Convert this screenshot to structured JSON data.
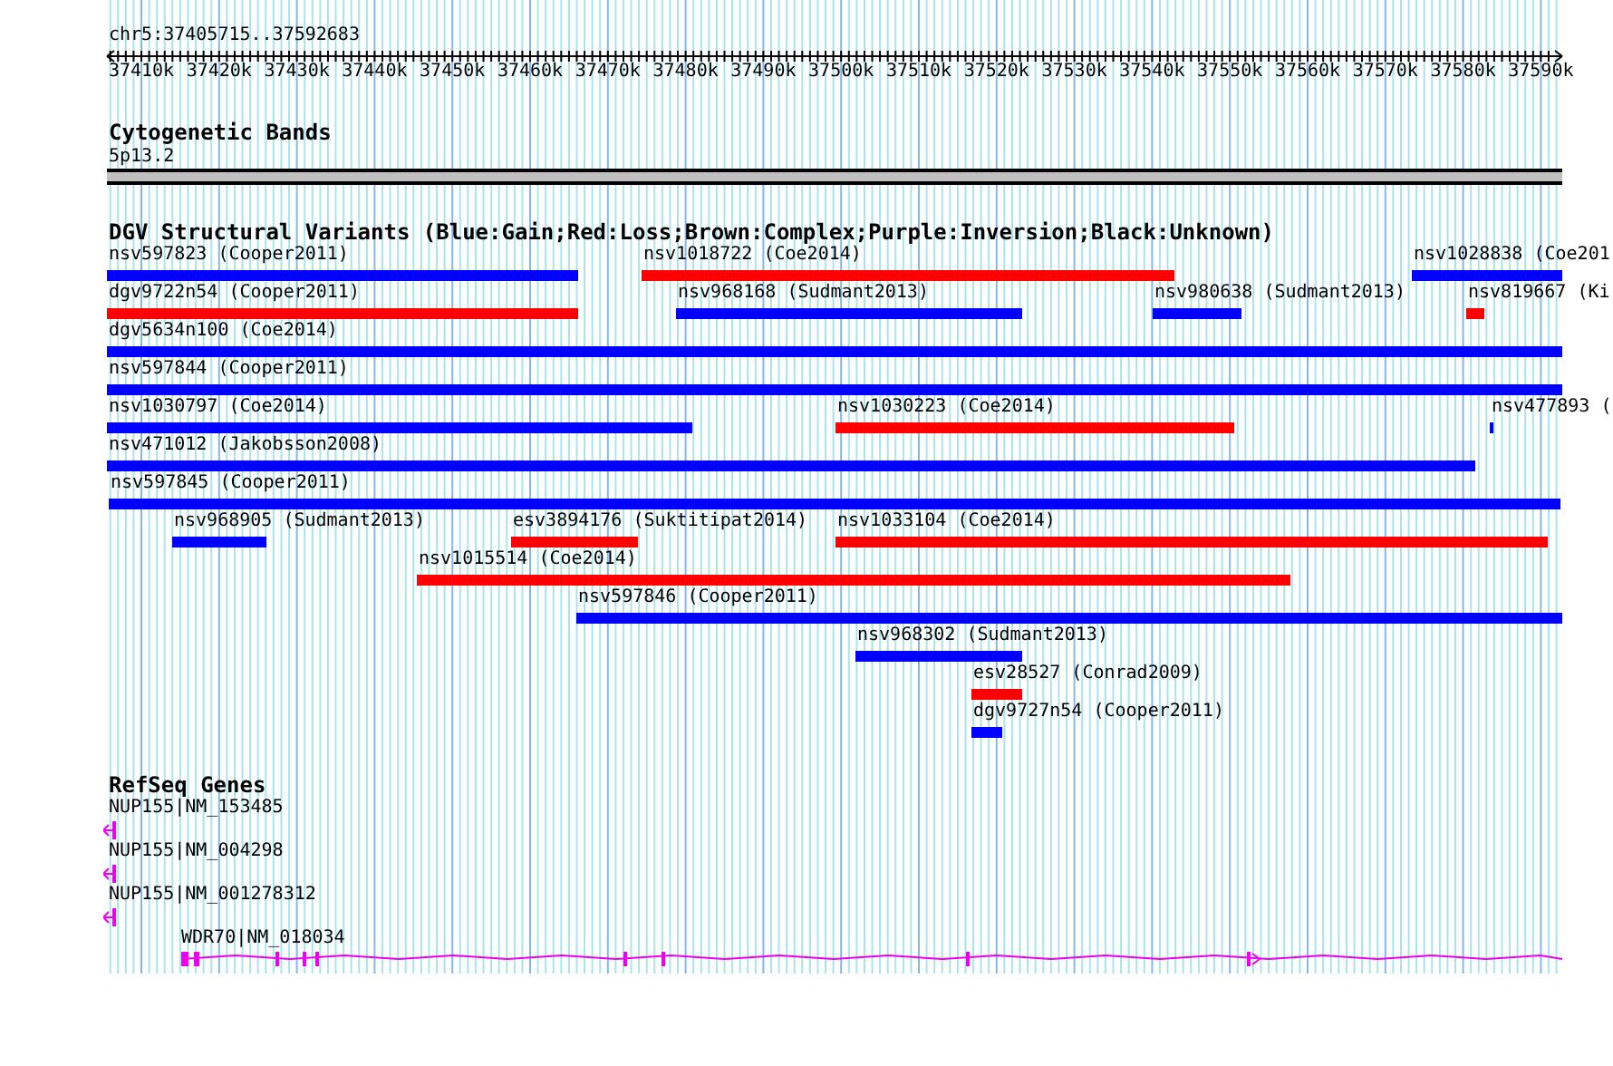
{
  "ruler": {
    "position": "chr5:37405715..37592683",
    "ticks": [
      "37410k",
      "37420k",
      "37430k",
      "37440k",
      "37450k",
      "37460k",
      "37470k",
      "37480k",
      "37490k",
      "37500k",
      "37510k",
      "37520k",
      "37530k",
      "37540k",
      "37550k",
      "37560k",
      "37570k",
      "37580k",
      "37590k"
    ]
  },
  "tracks": [
    {
      "kind": "bands",
      "title": "Cytogenetic Bands",
      "label": "5p13.2"
    },
    {
      "kind": "variants",
      "title": "DGV Structural Variants (Blue:Gain;Red:Loss;Brown:Complex;Purple:Inversion;Black:Unknown)",
      "rows": [
        [
          {
            "label": "nsv597823 (Cooper2011)",
            "color": "#0000ff"
          },
          {
            "label": "nsv1018722 (Coe2014)",
            "color": "#ff0000"
          },
          {
            "label": "nsv1028838 (Coe201",
            "color": "#0000ff"
          }
        ],
        [
          {
            "label": "dgv9722n54 (Cooper2011)",
            "color": "#ff0000"
          },
          {
            "label": "nsv968168 (Sudmant2013)",
            "color": "#0000ff"
          },
          {
            "label": "nsv980638 (Sudmant2013)",
            "color": "#0000ff"
          },
          {
            "label": "nsv819667 (Ki",
            "color": "#ff0000"
          }
        ],
        [
          {
            "label": "dgv5634n100 (Coe2014)",
            "color": "#0000ff"
          }
        ],
        [
          {
            "label": "nsv597844 (Cooper2011)",
            "color": "#0000ff"
          }
        ],
        [
          {
            "label": "nsv1030797 (Coe2014)",
            "color": "#0000ff"
          },
          {
            "label": "nsv1030223 (Coe2014)",
            "color": "#ff0000"
          },
          {
            "label": "nsv477893 (",
            "color": "#0000ff"
          }
        ],
        [
          {
            "label": "nsv471012 (Jakobsson2008)",
            "color": "#0000ff"
          }
        ],
        [
          {
            "label": "nsv597845 (Cooper2011)",
            "color": "#0000ff"
          }
        ],
        [
          {
            "label": "nsv968905 (Sudmant2013)",
            "color": "#0000ff"
          },
          {
            "label": "esv3894176 (Suktitipat2014)",
            "color": "#ff0000"
          },
          {
            "label": "nsv1033104 (Coe2014)",
            "color": "#ff0000"
          }
        ],
        [
          {
            "label": "nsv1015514 (Coe2014)",
            "color": "#ff0000"
          }
        ],
        [
          {
            "label": "nsv597846 (Cooper2011)",
            "color": "#0000ff"
          }
        ],
        [
          {
            "label": "nsv968302 (Sudmant2013)",
            "color": "#0000ff"
          }
        ],
        [
          {
            "label": "esv28527 (Conrad2009)",
            "color": "#ff0000"
          }
        ],
        [
          {
            "label": "dgv9727n54 (Cooper2011)",
            "color": "#0000ff"
          }
        ]
      ]
    },
    {
      "kind": "genes",
      "title": "RefSeq Genes",
      "genes": [
        {
          "label": "NUP155|NM_153485",
          "kind": "reverse"
        },
        {
          "label": "NUP155|NM_004298",
          "kind": "reverse"
        },
        {
          "label": "NUP155|NM_001278312",
          "kind": "reverse"
        },
        {
          "label": "WDR70|NM_018034",
          "kind": "forward"
        }
      ]
    }
  ]
}
